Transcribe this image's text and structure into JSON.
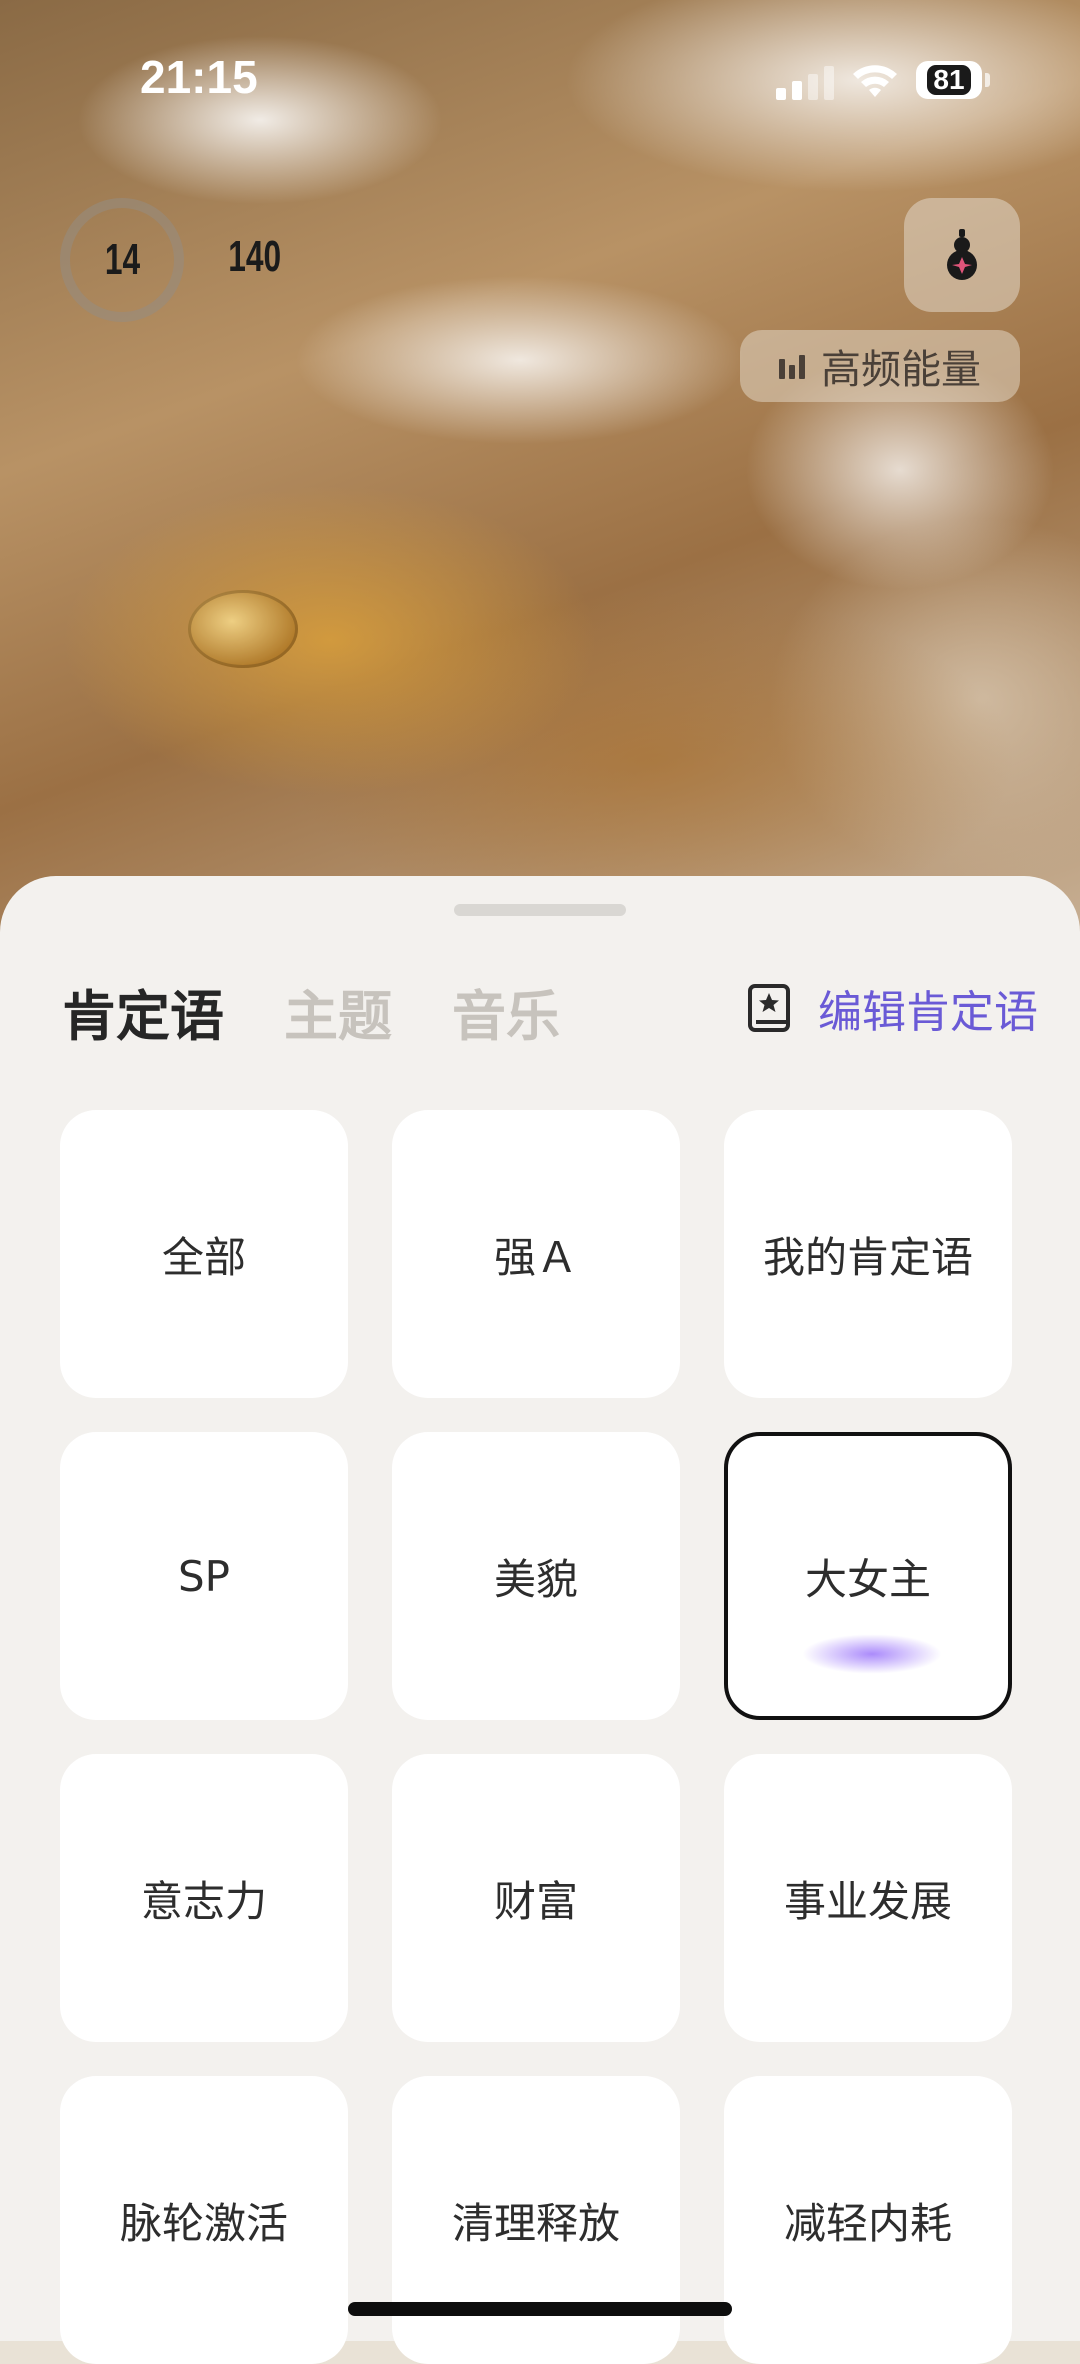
{
  "status_bar": {
    "time": "21:15",
    "battery": "81"
  },
  "header": {
    "ring_value": "14",
    "count": "140",
    "energy_label": "高频能量"
  },
  "sheet": {
    "tabs": [
      {
        "label": "肯定语",
        "active": true
      },
      {
        "label": "主题",
        "active": false
      },
      {
        "label": "音乐",
        "active": false
      }
    ],
    "edit_label": "编辑肯定语",
    "categories": [
      {
        "label": "全部"
      },
      {
        "label": "强Ａ"
      },
      {
        "label": "我的肯定语"
      },
      {
        "label": "SP"
      },
      {
        "label": "美貌"
      },
      {
        "label": "大女主",
        "selected": true
      },
      {
        "label": "意志力"
      },
      {
        "label": "财富"
      },
      {
        "label": "事业发展"
      },
      {
        "label": "脉轮激活"
      },
      {
        "label": "清理释放"
      },
      {
        "label": "减轻内耗"
      }
    ]
  },
  "colors": {
    "accent": "#6a5ad6",
    "selected_glow": "#9a80f8"
  },
  "icons": [
    "signal-icon",
    "wifi-icon",
    "battery-icon",
    "gourd-icon",
    "bars-icon",
    "book-star-icon"
  ]
}
